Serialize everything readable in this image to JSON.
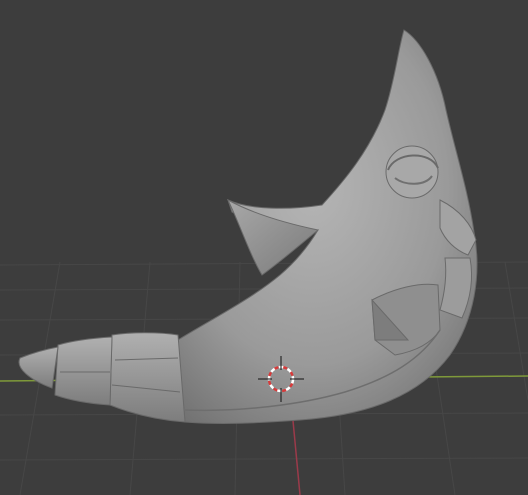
{
  "viewport": {
    "background": "#3d3d3d",
    "grid_color": "#4a4a4a",
    "x_axis_color": "#7f9a3a",
    "y_axis_color": "#9b3a4a",
    "model_color": "#9a9a9a"
  },
  "icons": {
    "cursor": "3d-cursor-icon"
  }
}
